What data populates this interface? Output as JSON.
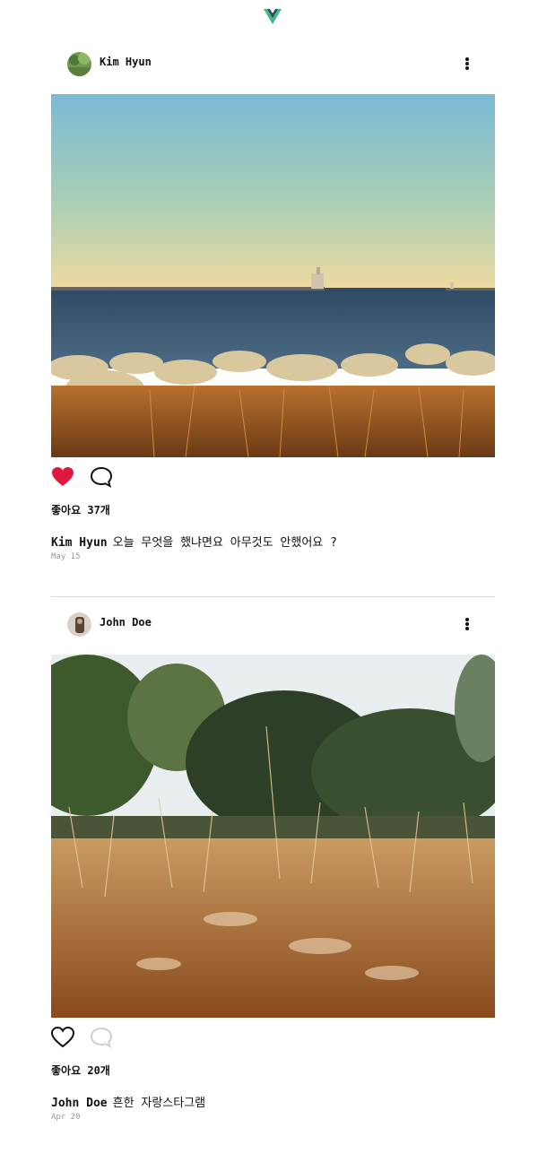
{
  "app": {
    "logo_icon": "vue-logo-icon",
    "logo_colors": [
      "#41b883",
      "#35495e"
    ]
  },
  "posts": [
    {
      "username": "Kim Hyun",
      "avatar_icon": "avatar-photo-icon",
      "image_alt": "lighthouse seaside photo",
      "liked": true,
      "likes_label": "좋아요 37개",
      "caption_user": "Kim Hyun",
      "caption_text": "오늘 무엇을 했냐면요 아무것도 안했어요 ?",
      "date": "May 15"
    },
    {
      "username": "John Doe",
      "avatar_icon": "avatar-photo-icon",
      "image_alt": "dry grass field photo",
      "liked": false,
      "likes_label": "좋아요 20개",
      "caption_user": "John Doe",
      "caption_text": "흔한 자랑스타그램",
      "date": "Apr 20"
    }
  ],
  "colors": {
    "heart_liked": "#e3173e",
    "icon_inactive": "#cfcfcf"
  }
}
